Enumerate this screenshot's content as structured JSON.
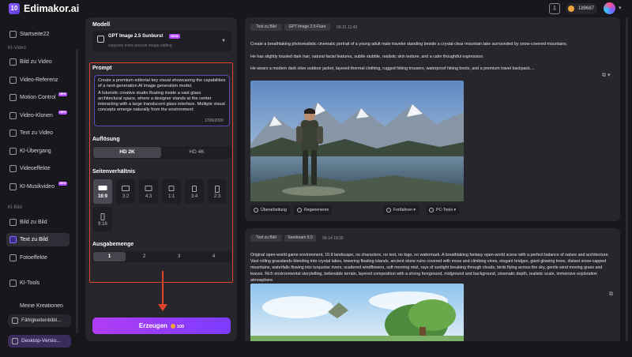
{
  "app": {
    "logo_text": "10",
    "name": "Edimakor.ai",
    "credits": "189687"
  },
  "sidebar": {
    "home": "Startseite22",
    "sections": [
      "KI-Video",
      "KI-Bild"
    ],
    "video_items": [
      "Bild zu Video",
      "Video-Referenz",
      "Motion Control",
      "Video-Klonen",
      "Text zu Video",
      "KI-Übergang",
      "Videoeffekte",
      "KI-Musikvideo"
    ],
    "image_items": [
      "Bild zu Bild",
      "Text zu Bild",
      "Fotoeffekte"
    ],
    "tools": "KI-Tools",
    "creations": "Meine Kreationen",
    "skills_button": "Fähigkeitenbibli...",
    "desktop_button": "Desktop-Versio...",
    "new_badge": "NEW"
  },
  "panel": {
    "model_label": "Modell",
    "model_name": "GPT Image 2.5 Sunburst",
    "model_badge": "NEW",
    "model_sub": "supports more precise image editing",
    "prompt_label": "Prompt",
    "prompt_p1": "Create a premium editorial key visual showcasing the capabilities of a next-generation AI image generation model.",
    "prompt_p2": "A futuristic creative studio floating inside a vast glass architectural space, where a designer stands at the center interacting with a large translucent glass interface. Multiple visual concepts emerge naturally from the environment:",
    "counter": "1706/2000",
    "resolution_label": "Auflösung",
    "resolutions": [
      "HD 2K",
      "HD 4K"
    ],
    "ratio_label": "Seitenverhältnis",
    "ratios": [
      "16:9",
      "3:2",
      "4:3",
      "1:1",
      "3:4",
      "2:3",
      "9:16"
    ],
    "count_label": "Ausgabemenge",
    "counts": [
      "1",
      "2",
      "3",
      "4"
    ],
    "generate_label": "Erzeugen",
    "generate_cost": "100"
  },
  "card1": {
    "tag1": "Text zu Bild",
    "tag2": "GPT Image 2.5-Flare",
    "date": "09-21 11:43",
    "line1": "Create a breathtaking photorealistic cinematic portrait of a young adult male traveler standing beside a crystal-clear mountain lake surrounded by snow-covered mountains.",
    "line2": "He has slightly tousled dark hair, natural facial features, subtle stubble, realistic skin texture, and a calm thoughtful expression.",
    "line3": "He wears a modern dark olive outdoor jacket, layered thermal clothing, rugged hiking trousers, waterproof hiking boots, and a premium travel backpack....",
    "actions": [
      "Überarbeitung",
      "Regenerieren",
      "Fortfahren",
      "PC-Tools"
    ]
  },
  "card2": {
    "tag1": "Text zu Bild",
    "tag2": "Seedream 5.0",
    "date": "09-14 18:35",
    "text": "Original open-world game environment, 16:9 landscape, no characters, no text, no logo, no watermark. A breathtaking fantasy open-world scene with a perfect balance of nature and architecture. Vast rolling grasslands blending into crystal lakes, towering floating islands, ancient stone ruins covered with moss and climbing vines, elegant bridges, giant glowing trees, distant snow-capped mountains, waterfalls flowing into turquoise rivers, scattered windflowers, soft morning mist, rays of sunlight breaking through clouds, birds flying across the sky, gentle wind moving grass and leaves. Rich environmental storytelling, believable terrain, layered composition with a strong foreground, midground and background, cinematic depth, realistic scale, immersive exploration atmosphere."
  }
}
